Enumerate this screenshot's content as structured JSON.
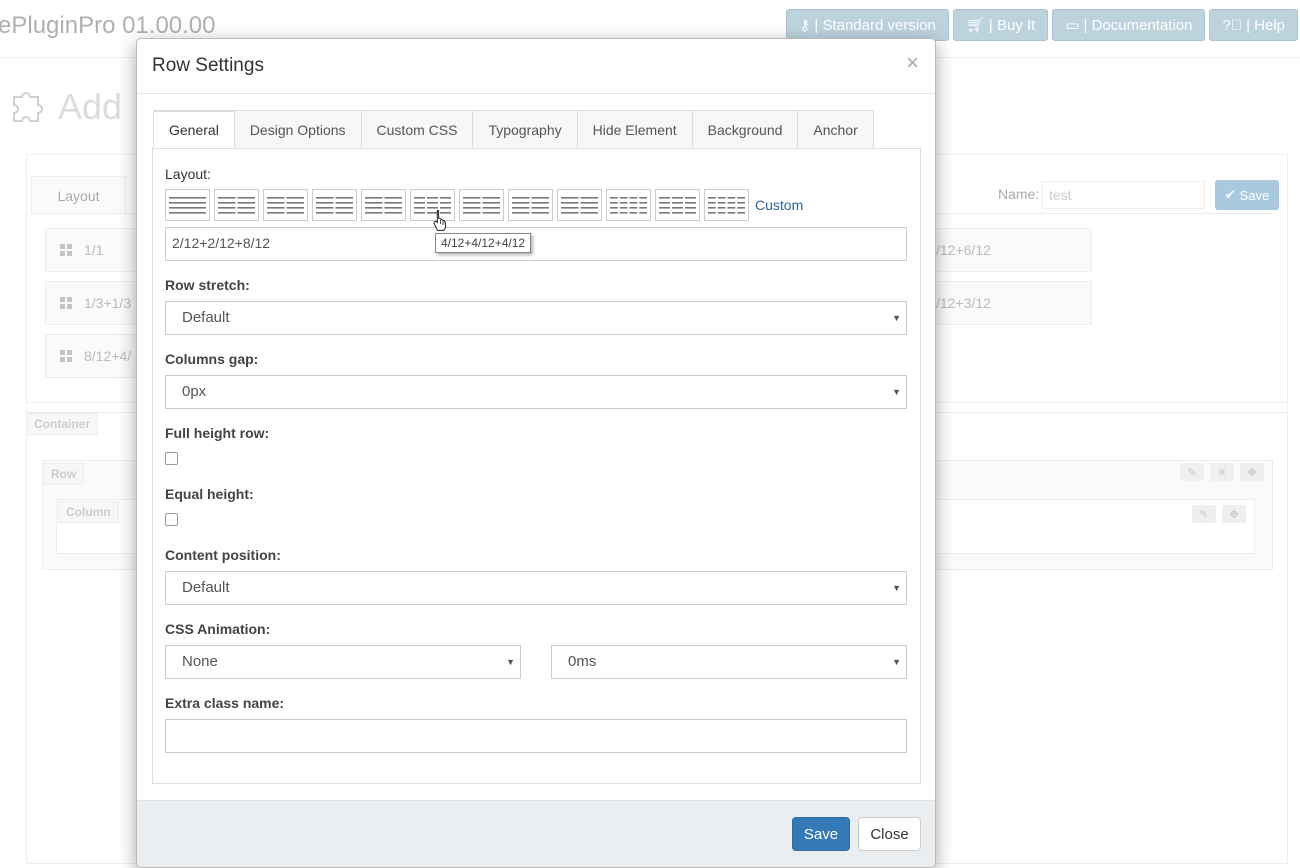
{
  "app": {
    "title": "ePluginPro 01.00.00",
    "top_buttons": [
      "| Standard version",
      "| Buy It",
      "| Documentation",
      "| Help"
    ],
    "heading": "Add"
  },
  "background": {
    "tab_layout": "Layout",
    "name_label": "Name:",
    "name_value": "test",
    "save_label": "Save",
    "layout_items": [
      "1/1",
      "1/3+1/3",
      "8/12+4/"
    ],
    "right_items": [
      "/12+6/12",
      "/12+3/12"
    ],
    "container_label": "Container",
    "row_label": "Row",
    "column_label": "Column"
  },
  "modal": {
    "title": "Row Settings",
    "close_symbol": "×",
    "tabs": [
      "General",
      "Design Options",
      "Custom CSS",
      "Typography",
      "Hide Element",
      "Background",
      "Anchor"
    ],
    "layout_label": "Layout:",
    "custom_link": "Custom",
    "layout_value": "2/12+2/12+8/12",
    "tooltip": "4/12+4/12+4/12",
    "row_stretch_label": "Row stretch:",
    "row_stretch_value": "Default",
    "columns_gap_label": "Columns gap:",
    "columns_gap_value": "0px",
    "full_height_label": "Full height row:",
    "full_height_checked": false,
    "equal_height_label": "Equal height:",
    "equal_height_checked": false,
    "content_position_label": "Content position:",
    "content_position_value": "Default",
    "css_animation_label": "CSS Animation:",
    "css_animation_value": "None",
    "css_animation_delay": "0ms",
    "extra_class_label": "Extra class name:",
    "extra_class_value": "",
    "save_button": "Save",
    "close_button": "Close"
  },
  "colors": {
    "primary": "#337ab7",
    "link": "#2a6496",
    "footer_bg": "#ebeef0"
  }
}
